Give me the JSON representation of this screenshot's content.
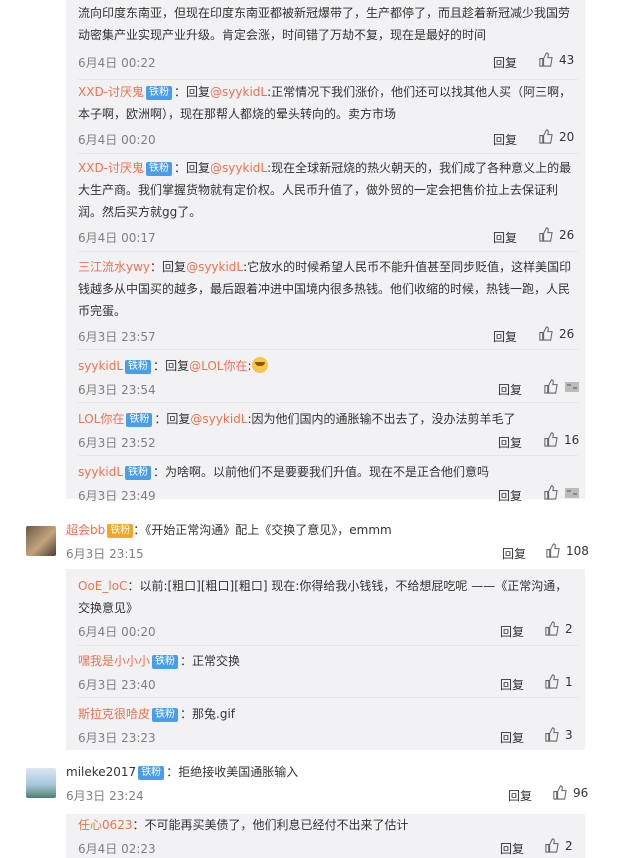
{
  "labels": {
    "reply": "回复",
    "reply_prefix": "回复",
    "iron_fan": "铁粉",
    "at_sym": "@",
    "colon": "：",
    "vip": "铁粉"
  },
  "comments": [
    {
      "text": "流向印度东南亚，但现在印度东南亚都被新冠爆带了，生产都停了，而且趁着新冠减少我国劳动密集产业实现产业升级。肯定会涨，时间错了万劫不复，现在是最好的时间",
      "time": "6月4日 00:22",
      "likes": "43"
    },
    {
      "user": "XXD-讨厌鬼",
      "at": "@syykidL",
      "text": ":正常情况下我们涨价，他们还可以找其他人买（阿三啊，本子啊，欧洲啊），现在那帮人都烧的晕头转向的。卖方市场",
      "time": "6月4日 00:20",
      "likes": "20"
    },
    {
      "user": "XXD-讨厌鬼",
      "at": "@syykidL",
      "text": ":现在全球新冠烧的热火朝天的，我们成了各种意义上的最大生产商。我们掌握货物就有定价权。人民币升值了，做外贸的一定会把售价拉上去保证利润。然后买方就gg了。",
      "time": "6月4日 00:17",
      "likes": "26"
    },
    {
      "user": "三江流水ywy",
      "at": "@syykidL",
      "text": ":它放水的时候希望人民币不能升值甚至同步贬值，这样美国印钱越多从中国买的越多，最后跟着冲进中国境内很多热钱。他们收缩的时候，热钱一跑，人民币完蛋。",
      "time": "6月3日 23:57",
      "likes": "26"
    },
    {
      "user": "syykidL",
      "at": "@LOL你在",
      "text": ":",
      "time": "6月3日 23:54",
      "likes": ""
    },
    {
      "user": "LOL你在",
      "at": "@syykidL",
      "text": ":因为他们国内的通胀输不出去了，没办法剪羊毛了",
      "time": "6月3日 23:52",
      "likes": "16"
    },
    {
      "user": "syykidL",
      "text": "：为啥啊。以前他们不是要要我们升值。现在不是正合他们意吗",
      "time": "6月3日 23:49",
      "likes": ""
    }
  ],
  "top1": {
    "user": "超会bb",
    "text": "：《开始正常沟通》配上《交换了意见》，emmm",
    "time": "6月3日 23:15",
    "likes": "108"
  },
  "sub1": [
    {
      "user": "OoE_loC",
      "text": "：以前:[粗口][粗口][粗口] 现在:你得给我小钱钱，不给想屁吃呢 ——《正常沟通，交换意见》",
      "time": "6月4日 00:20",
      "likes": "2"
    },
    {
      "user": "嘿我是小小小",
      "text": "：正常交换",
      "time": "6月3日 23:40",
      "likes": "1"
    },
    {
      "user": "斯拉克很哈皮",
      "text": "：那兔.gif",
      "time": "6月3日 23:23",
      "likes": "3"
    }
  ],
  "top2": {
    "user": "mileke2017",
    "text": "：拒绝接收美国通胀输入",
    "time": "6月3日 23:24",
    "likes": "96"
  },
  "sub2": [
    {
      "user": "任心0623",
      "text": "：不可能再买美债了，他们利息已经付不出来了估计",
      "time": "6月4日 02:23",
      "likes": "2"
    }
  ]
}
